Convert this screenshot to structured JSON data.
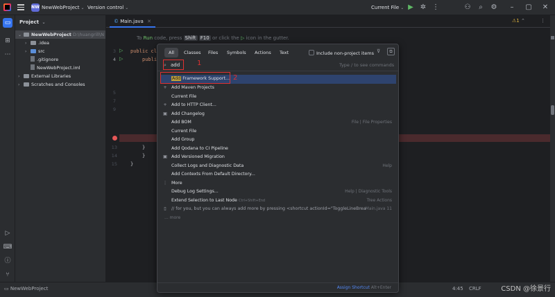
{
  "titlebar": {
    "project_badge": "NW",
    "project_name": "NewWebProject",
    "vcs": "Version control",
    "run_config": "Current File"
  },
  "project_panel": {
    "title": "Project",
    "tree": [
      {
        "label": "NewWebProject",
        "suffix": "D:\\huangrill\\N",
        "type": "folder",
        "level": 0,
        "expanded": true
      },
      {
        "label": ".idea",
        "type": "folder",
        "level": 1
      },
      {
        "label": "src",
        "type": "folder",
        "level": 1
      },
      {
        "label": ".gitignore",
        "type": "file",
        "level": 1
      },
      {
        "label": "NewWebProject.iml",
        "type": "file",
        "level": 1
      },
      {
        "label": "External Libraries",
        "type": "folder",
        "level": 0
      },
      {
        "label": "Scratches and Consoles",
        "type": "folder",
        "level": 0
      }
    ]
  },
  "editor": {
    "tab": "Main.java",
    "hint": {
      "prefix": "To",
      "run": "Run",
      "mid": "code, press",
      "key1": "Shift",
      "key2": "F10",
      "suffix": "or click the",
      "end": "icon in the gutter."
    },
    "warnings": "1",
    "lines": [
      {
        "num": "3",
        "code": "public cl"
      },
      {
        "num": "4",
        "code": "publi"
      },
      {
        "num": "5",
        "code": ""
      },
      {
        "num": "6",
        "code": ""
      },
      {
        "num": "7",
        "code": ""
      },
      {
        "num": "8",
        "code": ""
      },
      {
        "num": "9",
        "code": ""
      },
      {
        "num": "13",
        "code": "}"
      },
      {
        "num": "14",
        "code": "}"
      },
      {
        "num": "15",
        "code": "}"
      }
    ]
  },
  "popup": {
    "tabs": [
      "All",
      "Classes",
      "Files",
      "Symbols",
      "Actions",
      "Text"
    ],
    "include_label": "Include non-project items",
    "search_value": "add",
    "search_hint": "Type / to see commands",
    "annotation1": "1",
    "annotation2": "2",
    "items": [
      {
        "hl": "Add",
        "label": "Framework Support...",
        "right": "",
        "icon": ""
      },
      {
        "label": "Add Maven Projects",
        "right": "",
        "icon": "+"
      },
      {
        "label": "Current File",
        "right": "",
        "icon": ""
      },
      {
        "label": "Add to HTTP Client...",
        "right": "",
        "icon": "+"
      },
      {
        "label": "Add Changelog",
        "right": "",
        "icon": "▣"
      },
      {
        "label": "Add BOM",
        "right": "File | File Properties",
        "icon": ""
      },
      {
        "label": "Current File",
        "right": "",
        "icon": ""
      },
      {
        "label": "Add Group",
        "right": "",
        "icon": ""
      },
      {
        "label": "Add Qodana to CI Pipeline",
        "right": "",
        "icon": ""
      },
      {
        "label": "Add Versioned Migration",
        "right": "",
        "icon": "▣"
      },
      {
        "label": "Collect Logs and Diagnostic Data",
        "right": "Help",
        "icon": ""
      },
      {
        "label": "Add Contexts From Default Directory...",
        "right": "",
        "icon": ""
      },
      {
        "label": "More",
        "right": "",
        "icon": "⋮"
      },
      {
        "label": "Debug Log Settings...",
        "right": "Help | Diagnostic Tools",
        "icon": ""
      },
      {
        "label": "Extend Selection to Last Node",
        "shortcut": "Ctrl+Shift+End",
        "right": "Tree Actions",
        "icon": ""
      },
      {
        "label": "// for you, but you can always add more by pressing <shortcut actionId=\"ToggleLineBreakp",
        "right": "Main.java 11",
        "icon": "▯"
      }
    ],
    "more": "... more",
    "footer_link": "Assign Shortcut",
    "footer_keys": "Alt+Enter"
  },
  "statusbar": {
    "project": "NewWebProject",
    "pos": "4:45",
    "crlf": "CRLF"
  },
  "watermark": "CSDN @徐景行"
}
